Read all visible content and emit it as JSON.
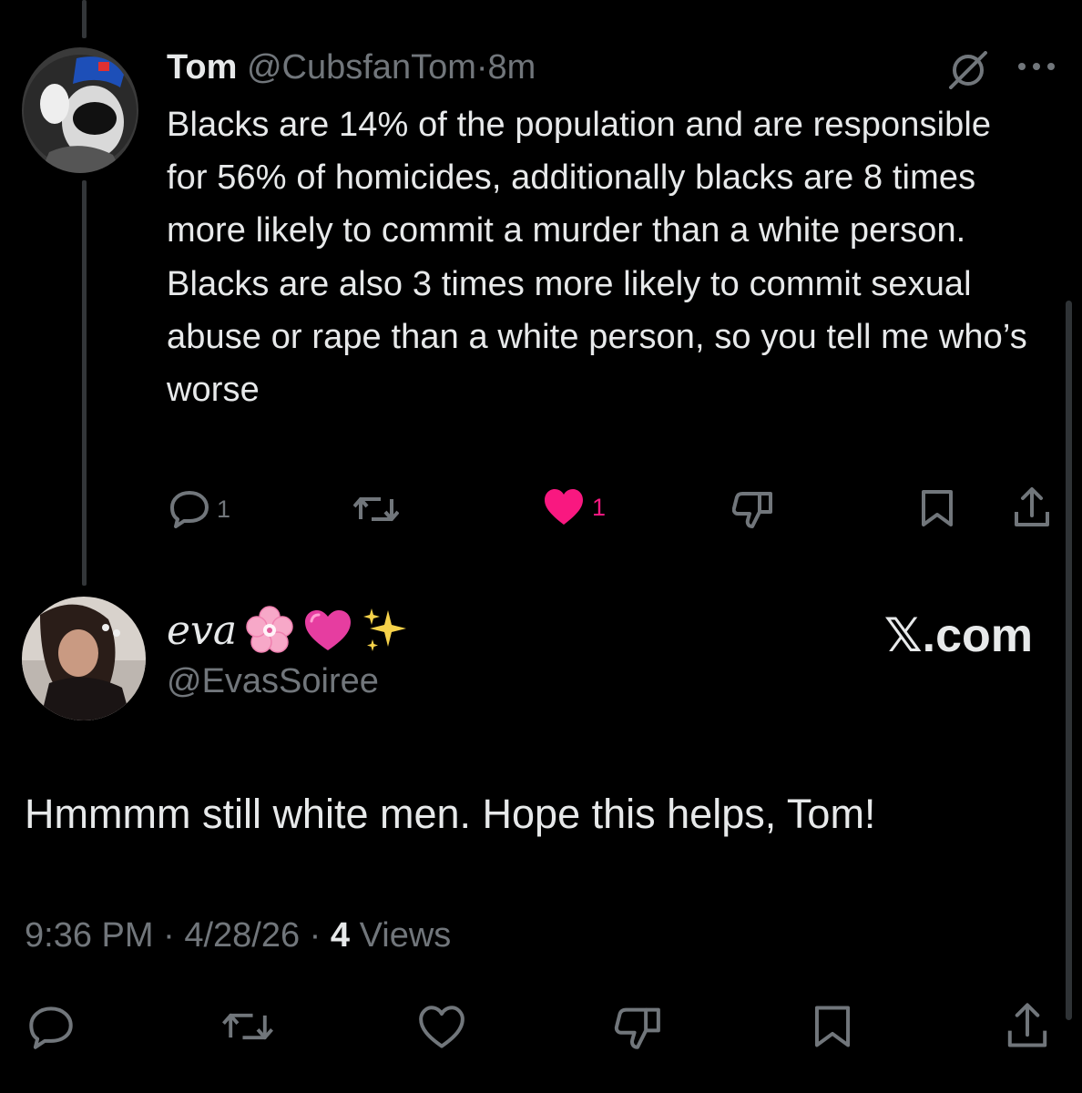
{
  "tweet": {
    "author_name": "Tom",
    "author_handle": "@CubsfanTom",
    "separator": "·",
    "time": "8m",
    "text": "Blacks are 14% of the population and are responsible for 56% of homicides, additionally blacks are 8 times more likely to commit a murder than a white person. Blacks are also 3 times more likely to commit sexual abuse or rape than a white person, so you tell me who’s worse",
    "reply_count": "1",
    "like_count": "1",
    "liked": true
  },
  "reply": {
    "author_name": "eva",
    "author_emojis": "🌸💗✨",
    "author_handle": "@EvasSoiree",
    "text": "Hmmmm still white men. Hope this helps, Tom!",
    "time": "9:36 PM",
    "date": "4/28/26",
    "views_count": "4",
    "views_label": "Views"
  },
  "brand": "𝕏.com",
  "icons": {
    "reply": "reply-icon",
    "repost": "repost-icon",
    "like": "heart-icon",
    "dislike": "thumbs-down-icon",
    "bookmark": "bookmark-icon",
    "share": "share-icon",
    "grok": "grok-icon",
    "more": "more-icon"
  },
  "colors": {
    "background": "#000000",
    "text": "#e7e9ea",
    "muted": "#71767b",
    "like_pink": "#f91880",
    "thread_line": "#333639"
  }
}
